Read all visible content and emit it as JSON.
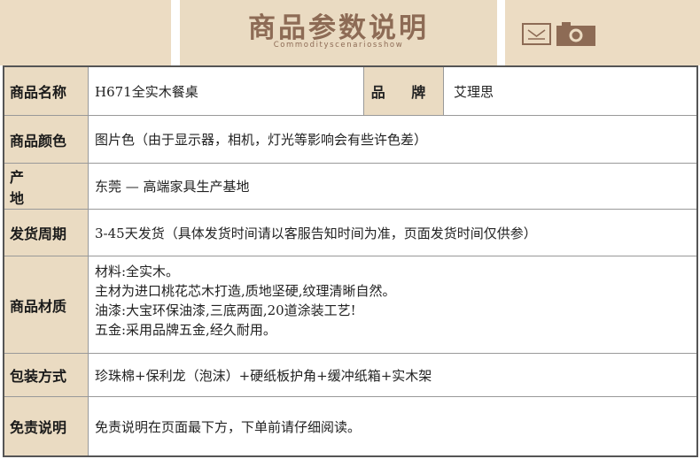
{
  "header": {
    "title": "商品参数说明",
    "subtitle": "Commodityscenariosshow",
    "icons": [
      "envelope-icon",
      "camera-icon"
    ],
    "accent_color": "#8d6b55",
    "band_color": "#eadbc2"
  },
  "table": {
    "name_label": "商品名称",
    "name_value": "H671全实木餐桌",
    "brand_label": "品 牌",
    "brand_value": "艾理思",
    "color_label": "商品颜色",
    "color_value": "图片色（由于显示器，相机，灯光等影响会有些许色差）",
    "origin_label": "产 地",
    "origin_value": "东莞 — 高端家具生产基地",
    "delivery_label": "发货周期",
    "delivery_value": "3-45天发货（具体发货时间请以客服告知时间为准，页面发货时间仅供参）",
    "material_label": "商品材质",
    "material_lines": [
      "材料:全实木。",
      "主材为进口桃花芯木打造,质地坚硬,纹理清晰自然。",
      "油漆:大宝环保油漆,三底两面,20道涂装工艺!",
      "五金:采用品牌五金,经久耐用。"
    ],
    "packaging_label": "包装方式",
    "packaging_value": "珍珠棉+保利龙（泡沫）+硬纸板护角+缓冲纸箱+实木架",
    "disclaimer_label": "免责说明",
    "disclaimer_value": "免责说明在页面最下方，下单前请仔细阅读。"
  }
}
